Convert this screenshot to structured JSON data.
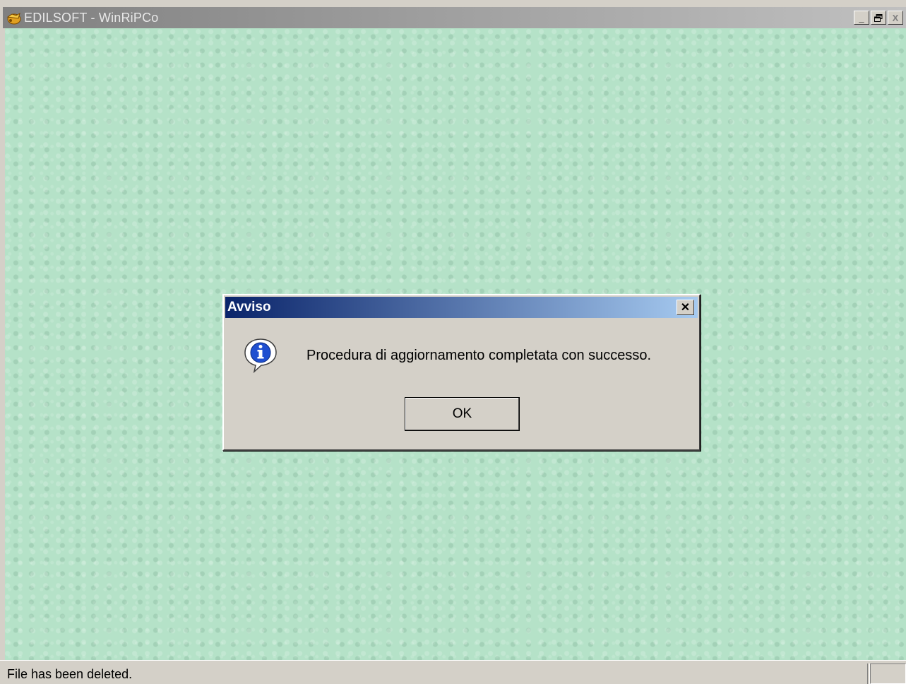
{
  "window": {
    "title": "EDILSOFT - WinRiPCo",
    "controls": {
      "minimize": "_",
      "restore": "❐",
      "close": "X"
    },
    "background_color": "#b5e2c8"
  },
  "statusbar": {
    "text": "File has been deleted."
  },
  "dialog": {
    "title": "Avviso",
    "close_label": "✕",
    "icon": "info-icon",
    "message": "Procedura di aggiornamento completata con successo.",
    "ok_label": "OK"
  }
}
